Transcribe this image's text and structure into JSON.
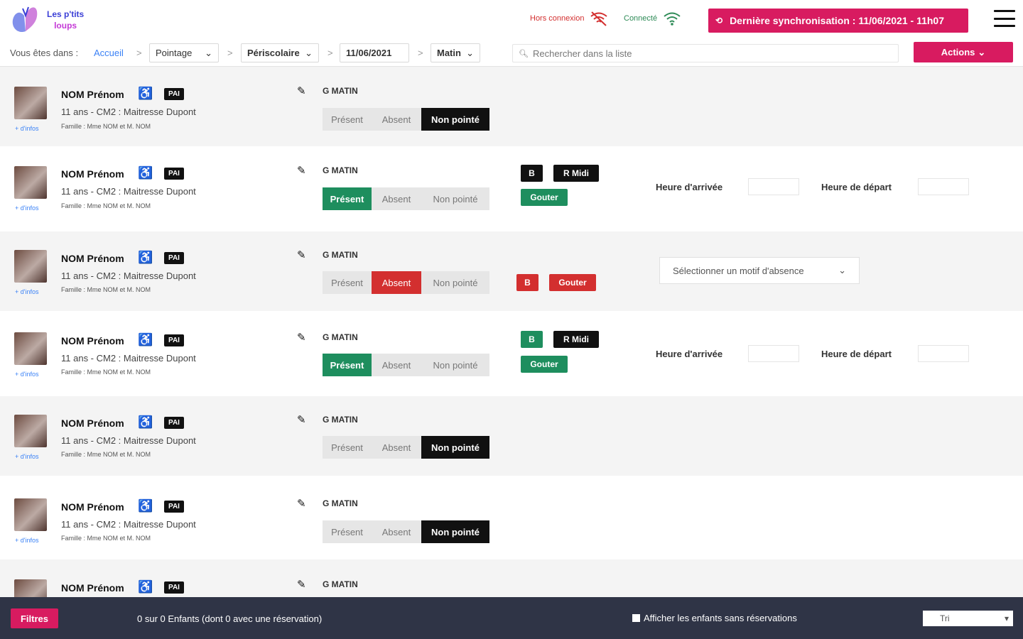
{
  "app": {
    "logo_line1": "Les p'tits",
    "logo_line2": "loups"
  },
  "connection": {
    "offline_label": "Hors connexion",
    "online_label": "Connecté"
  },
  "sync": {
    "label": "Dernière synchronisation : 11/06/2021 - 11h07"
  },
  "breadcrumb": {
    "prefix": "Vous êtes dans :",
    "home": "Accueil",
    "separator": ">",
    "module": "Pointage",
    "activity": "Périscolaire",
    "date": "11/06/2021",
    "period": "Matin"
  },
  "search": {
    "placeholder": "Rechercher dans la liste"
  },
  "actions": {
    "label": "Actions"
  },
  "status_labels": {
    "present": "Présent",
    "absent": "Absent",
    "none": "Non pointé"
  },
  "time_labels": {
    "arrival": "Heure d'arrivée",
    "departure": "Heure de départ"
  },
  "absence_select": {
    "placeholder": "Sélectionner un motif d'absence"
  },
  "children": [
    {
      "name": "NOM Prénom",
      "badge": "PAI",
      "details": "11 ans - CM2 : Maitresse Dupont",
      "family": "Famille : Mme NOM et M. NOM",
      "more": "+ d'infos",
      "group": "G MATIN",
      "status": "none"
    },
    {
      "name": "NOM Prénom",
      "badge": "PAI",
      "details": "11 ans - CM2 : Maitresse Dupont",
      "family": "Famille : Mme NOM et M. NOM",
      "more": "+ d'infos",
      "group": "G MATIN",
      "status": "present",
      "tags": [
        "B",
        "R Midi",
        "Gouter"
      ]
    },
    {
      "name": "NOM Prénom",
      "badge": "PAI",
      "details": "11 ans - CM2 : Maitresse Dupont",
      "family": "Famille : Mme NOM et M. NOM",
      "more": "+ d'infos",
      "group": "G MATIN",
      "status": "absent",
      "tags": [
        "B",
        "Gouter"
      ]
    },
    {
      "name": "NOM Prénom",
      "badge": "PAI",
      "details": "11 ans - CM2 : Maitresse Dupont",
      "family": "Famille : Mme NOM et M. NOM",
      "more": "+ d'infos",
      "group": "G MATIN",
      "status": "present",
      "tags": [
        "B",
        "R Midi",
        "Gouter"
      ]
    },
    {
      "name": "NOM Prénom",
      "badge": "PAI",
      "details": "11 ans - CM2 : Maitresse Dupont",
      "family": "Famille : Mme NOM et M. NOM",
      "more": "+ d'infos",
      "group": "G MATIN",
      "status": "none"
    },
    {
      "name": "NOM Prénom",
      "badge": "PAI",
      "details": "11 ans - CM2 : Maitresse Dupont",
      "family": "Famille : Mme NOM et M. NOM",
      "more": "+ d'infos",
      "group": "G MATIN",
      "status": "none"
    },
    {
      "name": "NOM Prénom",
      "badge": "PAI",
      "group": "G MATIN"
    }
  ],
  "footer": {
    "filters": "Filtres",
    "count": "0 sur 0 Enfants (dont 0 avec une réservation)",
    "show_without": "Afficher les enfants sans réservations",
    "sort": "Tri"
  },
  "colors": {
    "accent": "#d81b60",
    "present": "#1e8e5e",
    "absent": "#d32f2f",
    "footer": "#2f3446"
  }
}
